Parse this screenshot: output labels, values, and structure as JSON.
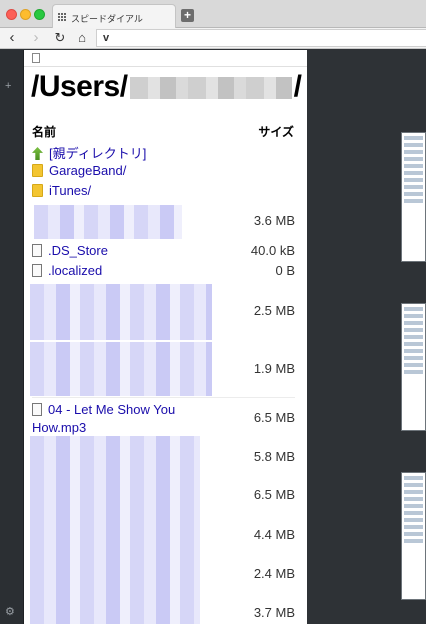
{
  "tab": {
    "title": "スピードダイアル"
  },
  "address": {
    "value": "v"
  },
  "page": {
    "title_prefix": "/Users/",
    "title_suffix": "/",
    "col_name": "名前",
    "col_size": "サイズ"
  },
  "rows": [
    {
      "name": "[親ディレクトリ]",
      "size": "",
      "icon": "parent-directory-icon"
    },
    {
      "name": "GarageBand/",
      "size": "",
      "icon": "folder-icon"
    },
    {
      "name": "iTunes/",
      "size": "",
      "icon": "folder-icon"
    },
    {
      "name": "",
      "size": "3.6 MB",
      "icon": ""
    },
    {
      "name": ".DS_Store",
      "size": "40.0 kB",
      "icon": "file-icon"
    },
    {
      "name": ".localized",
      "size": "0 B",
      "icon": "file-icon"
    },
    {
      "name": "",
      "size": "2.5 MB",
      "icon": ""
    },
    {
      "name": "",
      "size": "1.9 MB",
      "icon": ""
    },
    {
      "name": "04 - Let Me Show You",
      "name_line2": "How.mp3",
      "size": "6.5 MB",
      "icon": "file-icon"
    },
    {
      "name": "",
      "size": "5.8 MB",
      "icon": ""
    },
    {
      "name": "",
      "size": "6.5 MB",
      "icon": ""
    },
    {
      "name": "",
      "size": "4.4 MB",
      "icon": ""
    },
    {
      "name": "",
      "size": "2.4 MB",
      "icon": ""
    },
    {
      "name": "",
      "size": "3.7 MB",
      "icon": ""
    }
  ]
}
